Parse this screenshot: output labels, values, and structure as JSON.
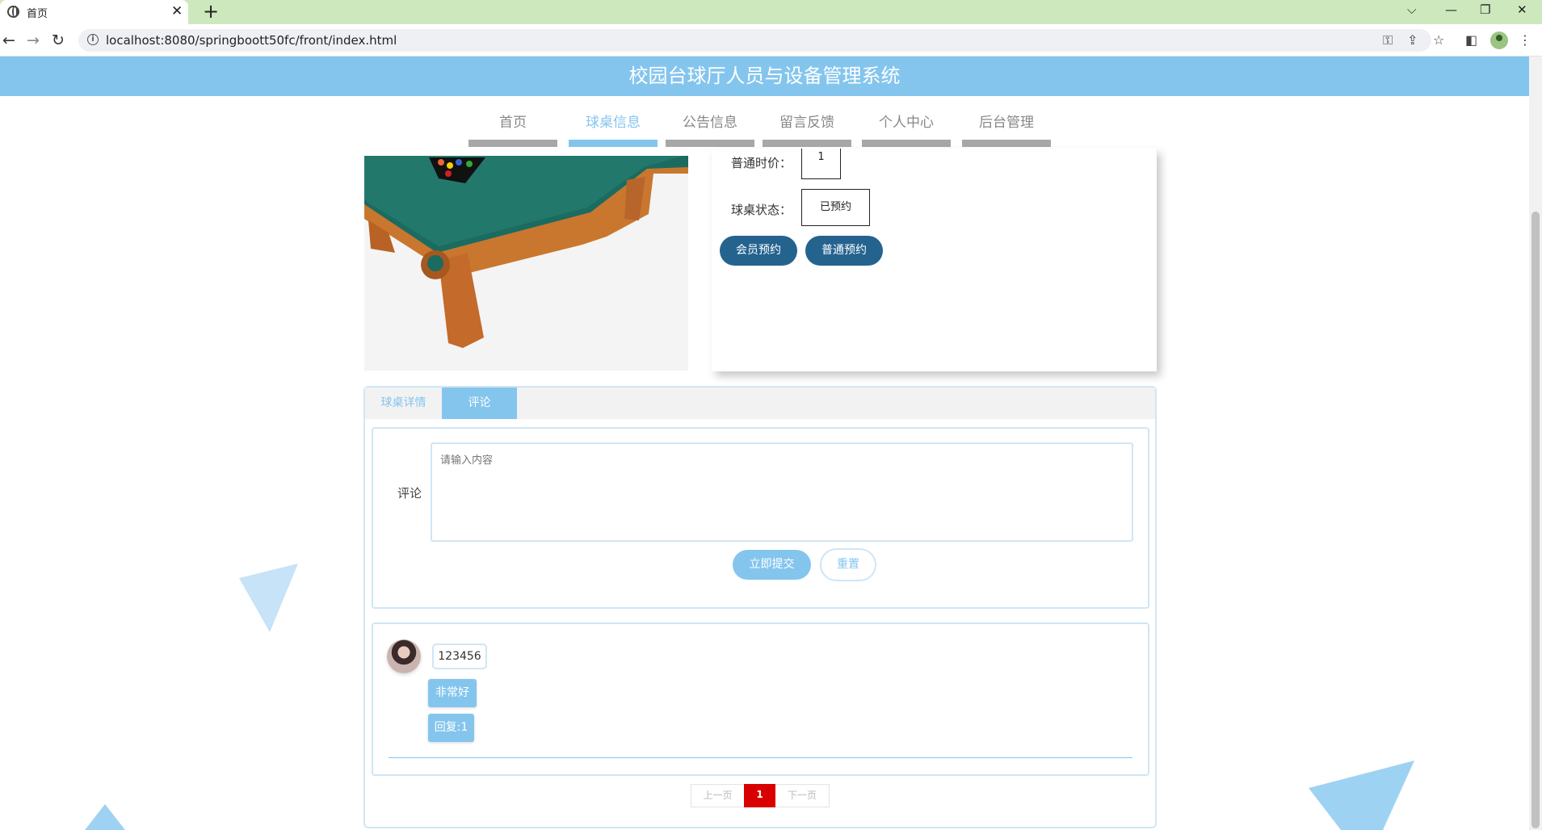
{
  "browser": {
    "tab_title": "首页",
    "new_tab_label": "+",
    "url": "localhost:8080/springboott50fc/front/index.html"
  },
  "site": {
    "title": "校园台球厅人员与设备管理系统",
    "nav": [
      {
        "label": "首页",
        "active": false
      },
      {
        "label": "球桌信息",
        "active": true
      },
      {
        "label": "公告信息",
        "active": false
      },
      {
        "label": "留言反馈",
        "active": false
      },
      {
        "label": "个人中心",
        "active": false
      },
      {
        "label": "后台管理",
        "active": false
      }
    ]
  },
  "detail": {
    "price_label": "普通时价：",
    "price_value": "1",
    "status_label": "球桌状态：",
    "status_value": "已预约",
    "member_booking": "会员预约",
    "normal_booking": "普通预约"
  },
  "tabs": {
    "detail_tab": "球桌详情",
    "comment_tab": "评论"
  },
  "comment_form": {
    "label": "评论",
    "placeholder": "请输入内容",
    "submit": "立即提交",
    "reset": "重置"
  },
  "comments": [
    {
      "user": "123456",
      "text": "非常好",
      "reply": "回复:1"
    }
  ],
  "pagination": {
    "prev": "上一页",
    "current": "1",
    "next": "下一页"
  },
  "colors": {
    "primary": "#84c5ee",
    "dark_button": "#25638f",
    "active_page": "#d80000"
  }
}
